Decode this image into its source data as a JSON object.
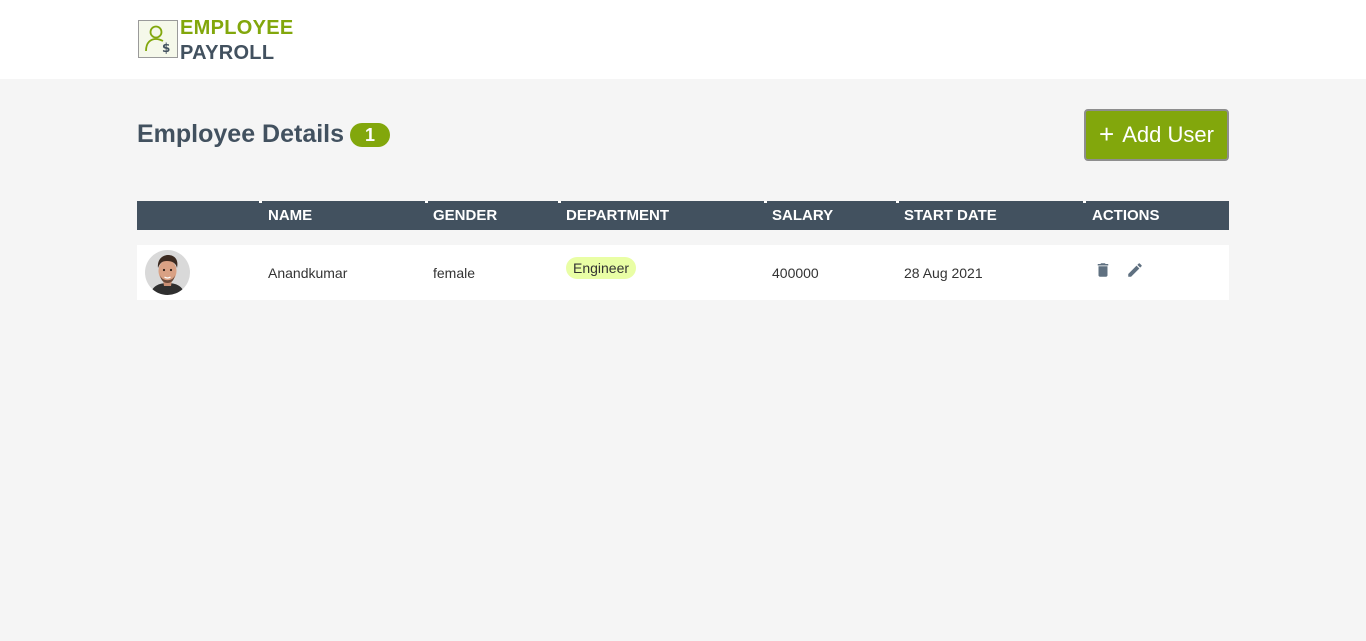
{
  "header": {
    "logo_icon": "employee-payroll-logo-icon",
    "logo_line1": "EMPLOYEE",
    "logo_line2": "PAYROLL"
  },
  "page": {
    "title": "Employee Details",
    "count": "1"
  },
  "add_button": {
    "icon": "plus-icon",
    "label": "Add User"
  },
  "table": {
    "columns": [
      "",
      "NAME",
      "GENDER",
      "DEPARTMENT",
      "SALARY",
      "START DATE",
      "ACTIONS"
    ],
    "rows": [
      {
        "avatar": "profile-photo-male",
        "name": "Anandkumar",
        "gender": "female",
        "department": "Engineer",
        "salary": "400000",
        "start_date": "28 Aug 2021",
        "actions": [
          "delete-icon",
          "edit-icon"
        ]
      }
    ]
  },
  "colors": {
    "brand_green": "#82a70c",
    "dark_slate": "#42515f",
    "tag_bg": "#e9fea5",
    "page_bg": "#f5f5f5"
  }
}
